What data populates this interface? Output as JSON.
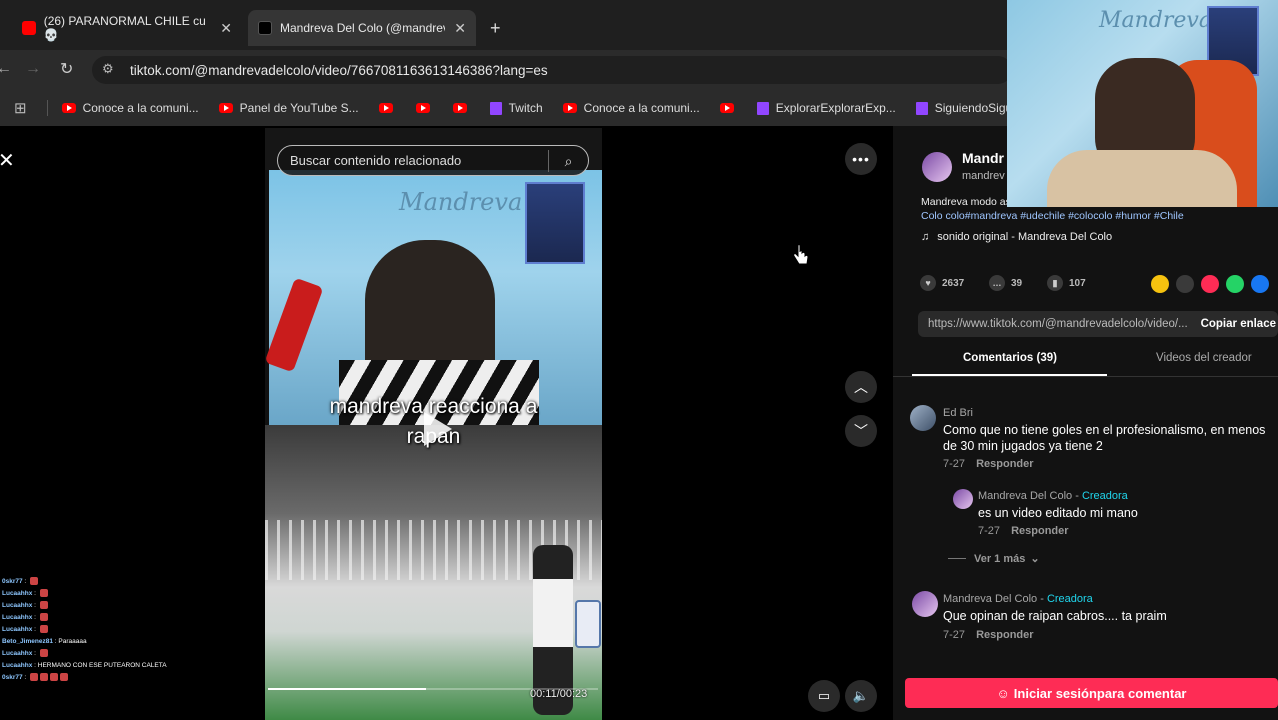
{
  "browser": {
    "tabs": [
      {
        "label": "(26) PARANORMAL CHILE cu 💀",
        "icon": "youtube-icon"
      },
      {
        "label": "Mandreva Del Colo (@mandrev",
        "icon": "tiktok-icon"
      }
    ],
    "new_tab": "+",
    "url": "tiktok.com/@mandrevadelcolo/video/7667081163613146386?lang=es",
    "bookmarks": [
      {
        "label": "Conoce a la comuni...",
        "icon": "youtube-icon"
      },
      {
        "label": "Panel de YouTube S...",
        "icon": "youtube-icon"
      },
      {
        "label": "",
        "icon": "youtube-icon"
      },
      {
        "label": "",
        "icon": "youtube-icon"
      },
      {
        "label": "",
        "icon": "youtube-icon"
      },
      {
        "label": "Twitch",
        "icon": "twitch-icon"
      },
      {
        "label": "Conoce a la comuni...",
        "icon": "youtube-icon"
      },
      {
        "label": "",
        "icon": "youtube-icon"
      },
      {
        "label": "ExplorarExplorarExp...",
        "icon": "twitch-icon"
      },
      {
        "label": "SiguiendoSiguiendo...",
        "icon": "twitch-icon"
      }
    ]
  },
  "player": {
    "search_placeholder": "Buscar contenido relacionado",
    "overlay_title_1": "mandreva reacciona a",
    "overlay_title_2": "rapan",
    "time": "00:11/00:23",
    "cam_watermark": "Mandreva"
  },
  "panel": {
    "author_name": "Mandr",
    "author_handle": "mandrev",
    "caption_1": "Mandreva modo aso analiza a Raipan y le desea lo mejor del mundo el",
    "caption_2": "Colo colo#mandreva #udechile #colocolo #humor #Chile",
    "sound": "sonido original - Mandreva Del Colo",
    "likes": "2637",
    "comments_count": "39",
    "saves": "107",
    "link": "https://www.tiktok.com/@mandrevadelcolo/video/...",
    "copy_label": "Copiar enlace",
    "tab_comments": "Comentarios (39)",
    "tab_creator": "Videos del creador",
    "comments": [
      {
        "user": "Ed Bri",
        "text_1": "Como que no tiene goles en el profesionalismo, en menos",
        "text_2": "de 30 min jugados ya tiene 2",
        "date": "7-27",
        "reply": "Responder"
      },
      {
        "user": "Mandreva Del Colo",
        "badge": "Creadora",
        "text_1": "es un video editado mi mano",
        "date": "7-27",
        "reply": "Responder"
      },
      {
        "user": "Mandreva Del Colo",
        "badge": "Creadora",
        "text_1": "Que opinan de raipan cabros.... ta praim",
        "date": "7-27",
        "reply": "Responder"
      }
    ],
    "view_more": "Ver 1 más",
    "login_cta": "Iniciar sesiónpara comentar",
    "creator_separator": " - "
  },
  "chat": [
    {
      "user": "0skr77",
      "msg": ""
    },
    {
      "user": "Lucaahhx",
      "msg": ""
    },
    {
      "user": "Lucaahhx",
      "msg": ""
    },
    {
      "user": "Lucaahhx",
      "msg": ""
    },
    {
      "user": "Lucaahhx",
      "msg": ""
    },
    {
      "user": "Beto_Jimenez81",
      "msg": "Paraaaaa"
    },
    {
      "user": "Lucaahhx",
      "msg": ""
    },
    {
      "user": "Lucaahhx",
      "msg": "HERMANO CON ESE PUTEARON CALETA"
    },
    {
      "user": "0skr77",
      "msg": ""
    }
  ],
  "colors": {
    "accent": "#fe2c55",
    "creator": "#20d5ec"
  }
}
